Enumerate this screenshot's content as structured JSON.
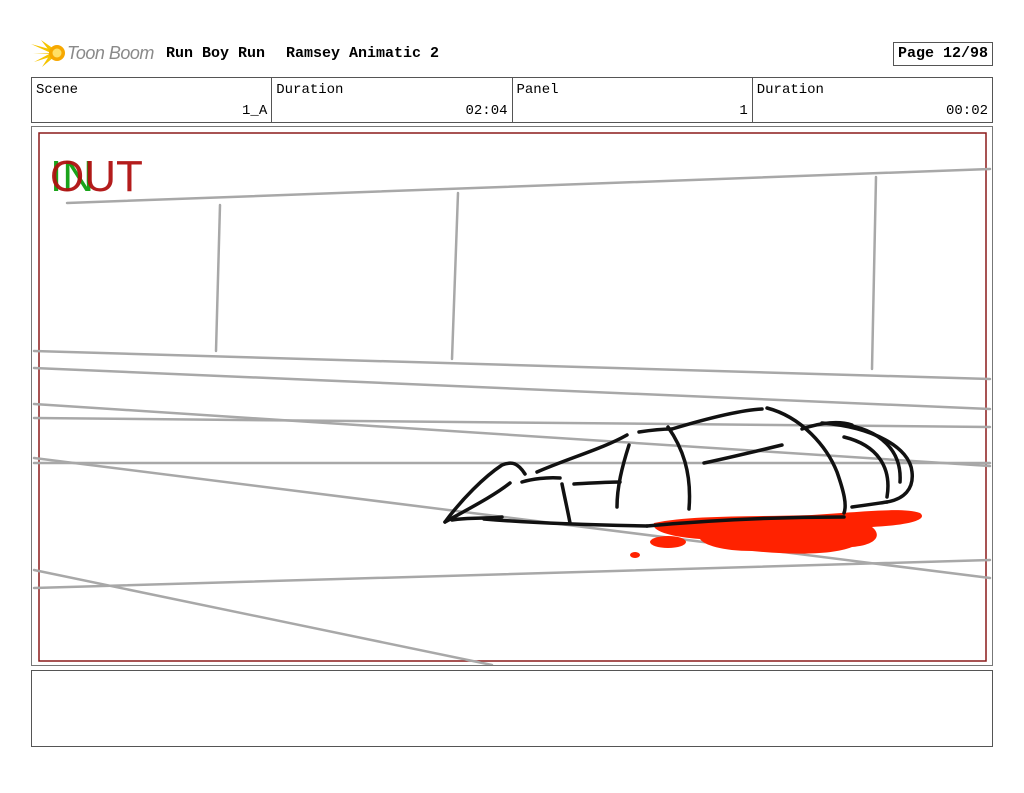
{
  "header": {
    "logo_text": "Toon Boom",
    "project_title": "Run Boy Run",
    "project_subtitle": "Ramsey Animatic 2",
    "page_label": "Page 12/98"
  },
  "info": {
    "scene_label": "Scene",
    "scene_value": "1_A",
    "scene_duration_label": "Duration",
    "scene_duration_value": "02:04",
    "panel_label": "Panel",
    "panel_value": "1",
    "panel_duration_label": "Duration",
    "panel_duration_value": "00:02"
  },
  "panel_overlay": {
    "in_label": "IN",
    "out_label": "OUT",
    "in_color": "#1aa31a",
    "out_color": "#b01010"
  },
  "colors": {
    "blood": "#ff2200",
    "frame": "#8b1a1a",
    "guide_lines": "#a8a8a8"
  },
  "notes": {
    "text": ""
  }
}
